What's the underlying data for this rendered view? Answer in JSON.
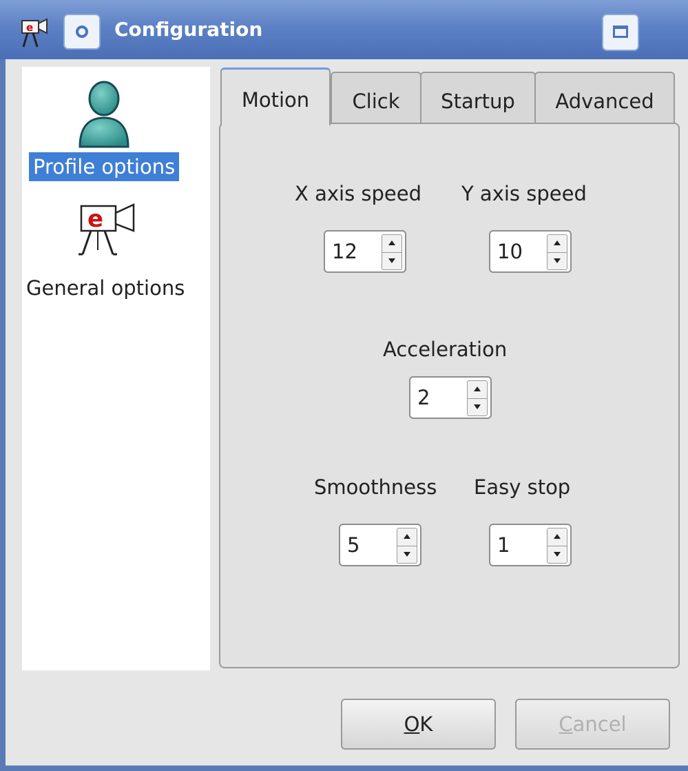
{
  "window": {
    "title": "Configuration",
    "icons": [
      "app-camera-icon",
      "window-menu-icon",
      "maximize-icon"
    ]
  },
  "sidebar": {
    "items": [
      {
        "label": "Profile options",
        "icon": "user-profile-icon",
        "selected": true
      },
      {
        "label": "General options",
        "icon": "camera-e-icon",
        "selected": false
      }
    ]
  },
  "tabs": [
    {
      "label": "Motion",
      "active": true
    },
    {
      "label": "Click",
      "active": false
    },
    {
      "label": "Startup",
      "active": false
    },
    {
      "label": "Advanced",
      "active": false
    }
  ],
  "motion": {
    "x_axis_speed": {
      "label": "X axis speed",
      "value": "12"
    },
    "y_axis_speed": {
      "label": "Y axis speed",
      "value": "10"
    },
    "acceleration": {
      "label": "Acceleration",
      "value": "2"
    },
    "smoothness": {
      "label": "Smoothness",
      "value": "5"
    },
    "easy_stop": {
      "label": "Easy stop",
      "value": "1"
    }
  },
  "buttons": {
    "ok": {
      "label": "OK",
      "mnemonic": "O",
      "rest": "K",
      "enabled": true
    },
    "cancel": {
      "label": "Cancel",
      "mnemonic": "C",
      "rest": "ancel",
      "enabled": false
    }
  },
  "colors": {
    "titlebar": "#5d81c5",
    "selection": "#3f7fd6",
    "window_bg": "#e6e6e6",
    "camera_red": "#cc1111"
  }
}
